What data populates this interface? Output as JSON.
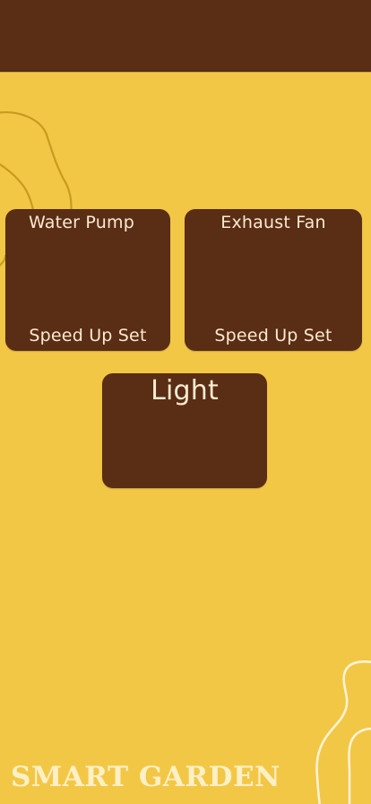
{
  "app": {
    "brand_title": "SMART GARDEN"
  },
  "cards": {
    "water_pump": {
      "title": "Water Pump",
      "action": "Speed Up Set"
    },
    "exhaust_fan": {
      "title": "Exhaust Fan",
      "action": "Speed Up Set"
    },
    "light": {
      "title": "Light"
    }
  },
  "theme": {
    "background": "#F3C746",
    "panel": "#5A2D15",
    "text_light": "#FBEAD0",
    "deco_line_top": "#C99A20",
    "deco_line_bottom": "#FFF4D8"
  }
}
